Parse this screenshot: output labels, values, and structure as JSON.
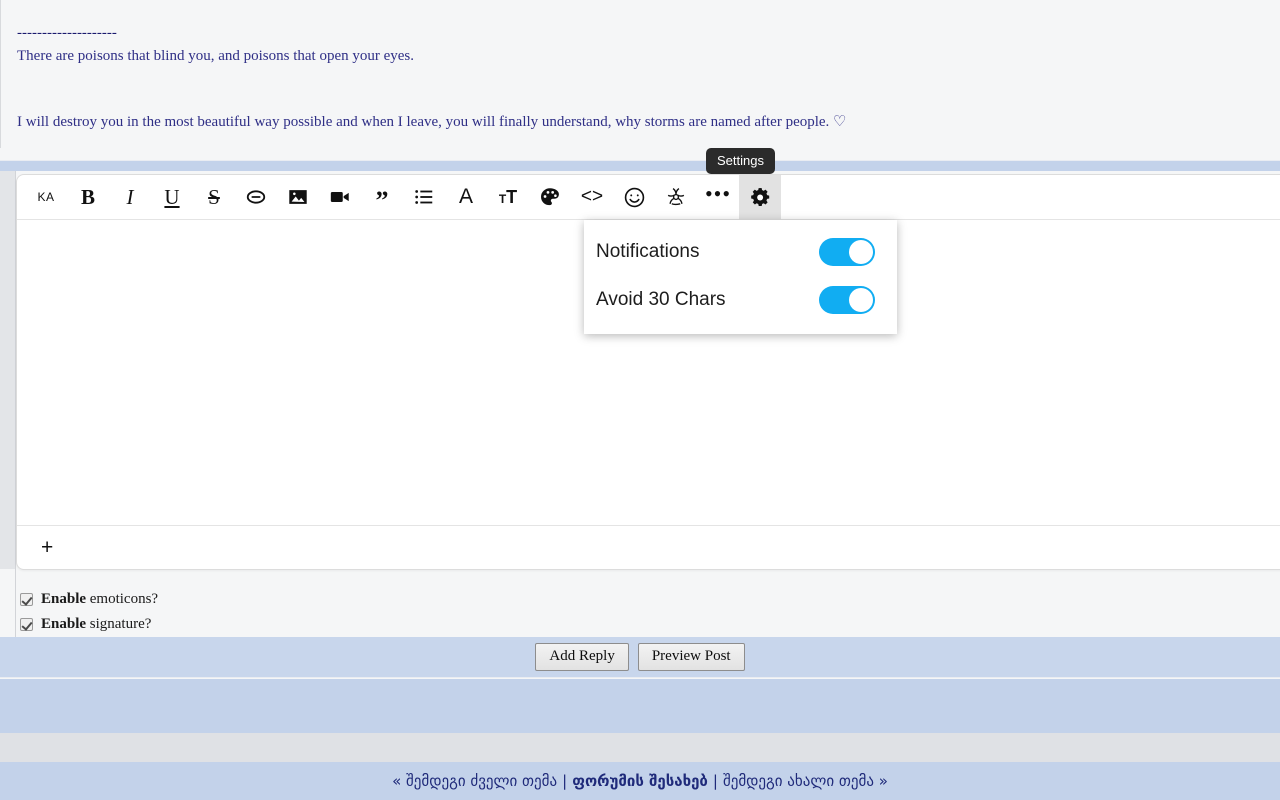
{
  "post": {
    "signature_rule": "--------------------",
    "line1": "There are poisons that blind you, and poisons that open your eyes.",
    "line2": "I will destroy you in the most beautiful way possible and when I leave, you will finally understand, why storms are named after people. ♡"
  },
  "toolbar": {
    "items": [
      {
        "name": "language-ka-button",
        "label": "KA",
        "kind": "lang",
        "active": false
      },
      {
        "name": "bold-button",
        "label": "B",
        "kind": "b",
        "active": false
      },
      {
        "name": "italic-button",
        "label": "I",
        "kind": "i",
        "active": false
      },
      {
        "name": "underline-button",
        "label": "U",
        "kind": "u",
        "active": false
      },
      {
        "name": "strikethrough-button",
        "label": "S",
        "kind": "s",
        "active": false
      },
      {
        "name": "link-icon",
        "label": "",
        "kind": "link",
        "active": false
      },
      {
        "name": "image-icon",
        "label": "",
        "kind": "image",
        "active": false
      },
      {
        "name": "video-icon",
        "label": "",
        "kind": "video",
        "active": false
      },
      {
        "name": "quote-button",
        "label": "”",
        "kind": "quote",
        "active": false
      },
      {
        "name": "list-icon",
        "label": "",
        "kind": "list",
        "active": false
      },
      {
        "name": "font-family-button",
        "label": "A",
        "kind": "letterA",
        "active": false
      },
      {
        "name": "font-size-button",
        "label": "T",
        "kind": "bigT",
        "active": false
      },
      {
        "name": "text-color-icon",
        "label": "",
        "kind": "palette",
        "active": false
      },
      {
        "name": "code-button",
        "label": "<>",
        "kind": "code",
        "active": false
      },
      {
        "name": "emoji-icon",
        "label": "",
        "kind": "smiley",
        "active": false
      },
      {
        "name": "biohazard-icon",
        "label": "",
        "kind": "biohazard",
        "active": false
      },
      {
        "name": "more-options-button",
        "label": "•••",
        "kind": "dots",
        "active": false
      },
      {
        "name": "settings-gear-icon",
        "label": "",
        "kind": "gear",
        "active": true
      }
    ],
    "add_label": "+"
  },
  "tooltip": {
    "text": "Settings"
  },
  "settings_panel": {
    "rows": [
      {
        "label": "Notifications",
        "on": true
      },
      {
        "label": "Avoid 30 Chars",
        "on": true
      }
    ],
    "accent_color": "#11adf2"
  },
  "options": [
    {
      "bold": "Enable",
      "rest": " emoticons?",
      "checked": true
    },
    {
      "bold": "Enable",
      "rest": " signature?",
      "checked": true
    }
  ],
  "actions": {
    "add_reply": "Add Reply",
    "preview_post": "Preview Post"
  },
  "footer_nav": {
    "prev": "« შემდეგი ძველი თემა",
    "middle": "ფორუმის შესახებ",
    "next": "შემდეგი ახალი თემა »",
    "separator": "|"
  },
  "colors": {
    "band_blue": "#c3d2ea",
    "band_gray": "#dfe1e5",
    "action_bar": "#c8d6ec",
    "post_text": "#2f2f86",
    "nav_text": "#1f2a7a"
  }
}
